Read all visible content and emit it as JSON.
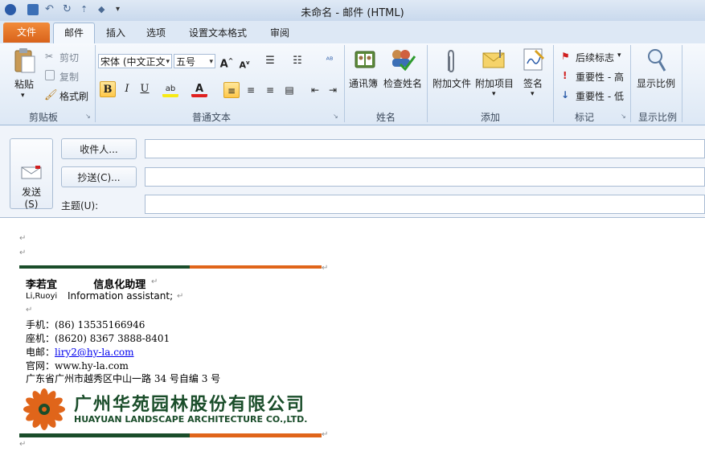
{
  "window": {
    "title": "未命名 - 邮件 (HTML)"
  },
  "tabs": [
    "文件",
    "邮件",
    "插入",
    "选项",
    "设置文本格式",
    "审阅"
  ],
  "clipboard": {
    "paste": "粘贴",
    "cut": "剪切",
    "copy": "复制",
    "format_painter": "格式刷",
    "group": "剪贴板"
  },
  "basic_text": {
    "font": "宋体 (中文正文",
    "size": "五号",
    "group": "普通文本"
  },
  "names": {
    "address_book": "通讯簿",
    "check_names": "检查姓名",
    "group": "姓名"
  },
  "include": {
    "attach_file": "附加文件",
    "attach_item": "附加项目",
    "signature": "签名",
    "group": "添加"
  },
  "tags": {
    "follow_up": "后续标志",
    "high_importance": "重要性 - 高",
    "low_importance": "重要性 - 低",
    "group": "标记"
  },
  "zoom": {
    "zoom": "显示比例",
    "group": "显示比例"
  },
  "compose": {
    "send": "发送",
    "send_key": "(S)",
    "to": "收件人...",
    "cc": "抄送(C)...",
    "subject": "主题(U):",
    "to_value": "",
    "cc_value": "",
    "subject_value": ""
  },
  "signature": {
    "name_title": "李若宜          信息化助理",
    "name_en": "Li,Ruoyi",
    "title_en": "Information assistant;",
    "mobile": "手机：(86) 13535166946",
    "phone": "座机：(8620) 8367 3888-8401",
    "email_label": "电邮：",
    "email": "liry2@hy-la.com",
    "website": "官网：www.hy-la.com",
    "address": "广东省广州市越秀区中山一路 34 号自编 3 号",
    "company_cn": "广州华苑园林股份有限公司",
    "company_en": "HUAYUAN LANDSCAPE ARCHITECTURE CO.,LTD."
  },
  "colors": {
    "accent_orange": "#e0651a",
    "brand_green": "#1a4d2a",
    "link_blue": "#0000ee"
  }
}
